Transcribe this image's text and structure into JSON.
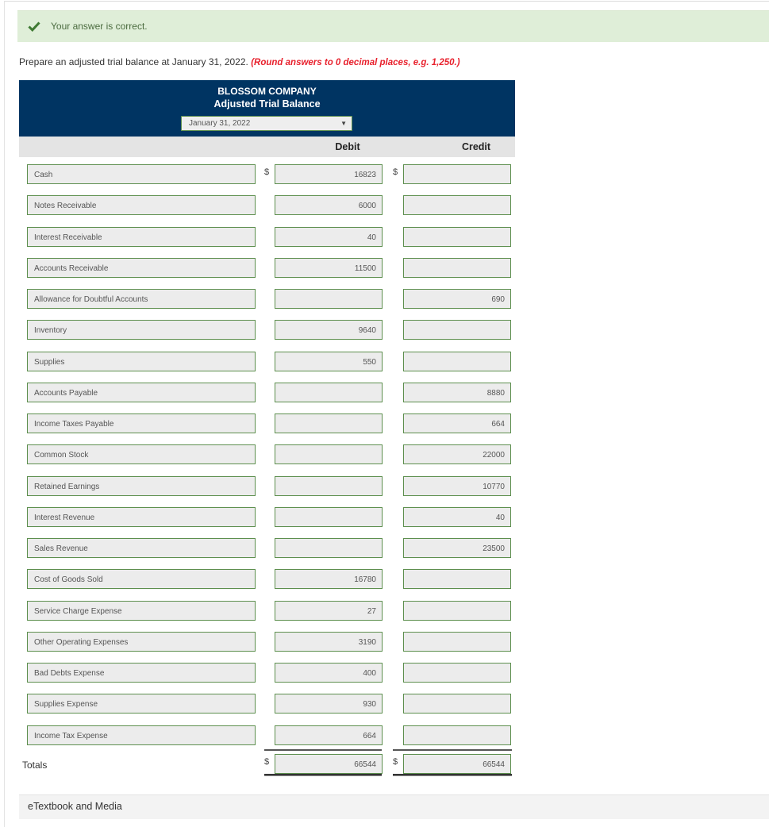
{
  "feedback": {
    "icon": "checkmark-icon",
    "message": "Your answer is correct.",
    "color": "#dfeed8"
  },
  "instructions": {
    "text": "Prepare an adjusted trial balance at January 31, 2022.",
    "note": "(Round answers to 0 decimal places, e.g. 1,250.)"
  },
  "statement": {
    "company": "BLOSSOM COMPANY",
    "title": "Adjusted Trial Balance",
    "date_selected": "January 31, 2022",
    "header_color": "#003462"
  },
  "columns": {
    "debit": "Debit",
    "credit": "Credit"
  },
  "currency_symbol": "$",
  "rows": [
    {
      "account": "Cash",
      "debit": "16823",
      "credit": ""
    },
    {
      "account": "Notes Receivable",
      "debit": "6000",
      "credit": ""
    },
    {
      "account": "Interest Receivable",
      "debit": "40",
      "credit": ""
    },
    {
      "account": "Accounts Receivable",
      "debit": "11500",
      "credit": ""
    },
    {
      "account": "Allowance for Doubtful Accounts",
      "debit": "",
      "credit": "690"
    },
    {
      "account": "Inventory",
      "debit": "9640",
      "credit": ""
    },
    {
      "account": "Supplies",
      "debit": "550",
      "credit": ""
    },
    {
      "account": "Accounts Payable",
      "debit": "",
      "credit": "8880"
    },
    {
      "account": "Income Taxes Payable",
      "debit": "",
      "credit": "664"
    },
    {
      "account": "Common Stock",
      "debit": "",
      "credit": "22000"
    },
    {
      "account": "Retained Earnings",
      "debit": "",
      "credit": "10770"
    },
    {
      "account": "Interest Revenue",
      "debit": "",
      "credit": "40"
    },
    {
      "account": "Sales Revenue",
      "debit": "",
      "credit": "23500"
    },
    {
      "account": "Cost of Goods Sold",
      "debit": "16780",
      "credit": ""
    },
    {
      "account": "Service Charge Expense",
      "debit": "27",
      "credit": ""
    },
    {
      "account": "Other Operating Expenses",
      "debit": "3190",
      "credit": ""
    },
    {
      "account": "Bad Debts Expense",
      "debit": "400",
      "credit": ""
    },
    {
      "account": "Supplies Expense",
      "debit": "930",
      "credit": ""
    },
    {
      "account": "Income Tax Expense",
      "debit": "664",
      "credit": ""
    }
  ],
  "totals": {
    "label": "Totals",
    "debit": "66544",
    "credit": "66544"
  },
  "etextbook": {
    "label": "eTextbook and Media"
  }
}
